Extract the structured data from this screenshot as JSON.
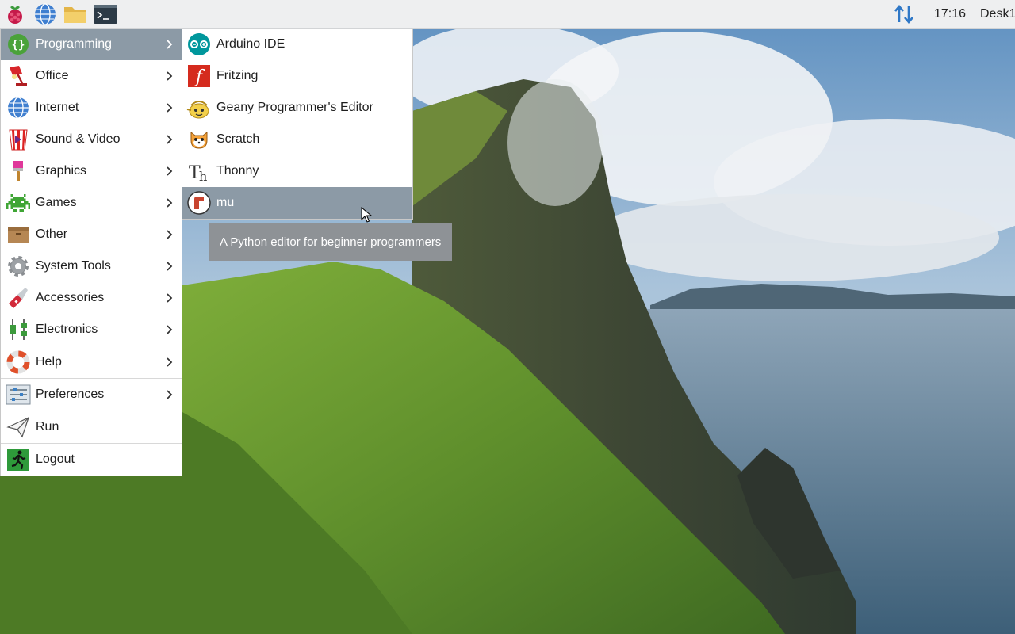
{
  "taskbar": {
    "launchers": [
      {
        "icon": "raspberry-icon"
      },
      {
        "icon": "globe-icon"
      },
      {
        "icon": "folder-icon"
      },
      {
        "icon": "terminal-icon"
      }
    ],
    "network_icon": "updown-arrows-icon",
    "clock": "17:16",
    "desktop_label": "Desk1"
  },
  "menu": {
    "items": [
      {
        "label": "Programming",
        "icon": "braces-icon",
        "submenu": true,
        "selected": true
      },
      {
        "label": "Office",
        "icon": "desk-lamp-icon",
        "submenu": true
      },
      {
        "label": "Internet",
        "icon": "globe-icon",
        "submenu": true
      },
      {
        "label": "Sound & Video",
        "icon": "popcorn-icon",
        "submenu": true
      },
      {
        "label": "Graphics",
        "icon": "paintbrush-icon",
        "submenu": true
      },
      {
        "label": "Games",
        "icon": "space-invader-icon",
        "submenu": true
      },
      {
        "label": "Other",
        "icon": "box-icon",
        "submenu": true
      },
      {
        "label": "System Tools",
        "icon": "gear-icon",
        "submenu": true
      },
      {
        "label": "Accessories",
        "icon": "pocket-knife-icon",
        "submenu": true
      },
      {
        "label": "Electronics",
        "icon": "components-icon",
        "submenu": true
      },
      {
        "label": "Help",
        "icon": "lifebuoy-icon",
        "submenu": true
      },
      {
        "label": "Preferences",
        "icon": "sliders-icon",
        "submenu": true
      },
      {
        "label": "Run",
        "icon": "paper-plane-icon",
        "submenu": false
      },
      {
        "label": "Logout",
        "icon": "exit-icon",
        "submenu": false
      }
    ]
  },
  "submenu": {
    "items": [
      {
        "label": "Arduino IDE",
        "icon": "arduino-icon"
      },
      {
        "label": "Fritzing",
        "icon": "fritzing-icon"
      },
      {
        "label": "Geany Programmer's Editor",
        "icon": "geany-icon"
      },
      {
        "label": "Scratch",
        "icon": "scratch-cat-icon"
      },
      {
        "label": "Thonny",
        "icon": "thonny-icon"
      },
      {
        "label": "mu",
        "icon": "mu-icon",
        "selected": true
      }
    ]
  },
  "tooltip": {
    "text": "A Python editor for beginner programmers"
  },
  "colors": {
    "taskbar_bg": "#eeeff0",
    "menu_selected_bg": "#8c9aa6",
    "tooltip_bg": "#8e9296"
  }
}
